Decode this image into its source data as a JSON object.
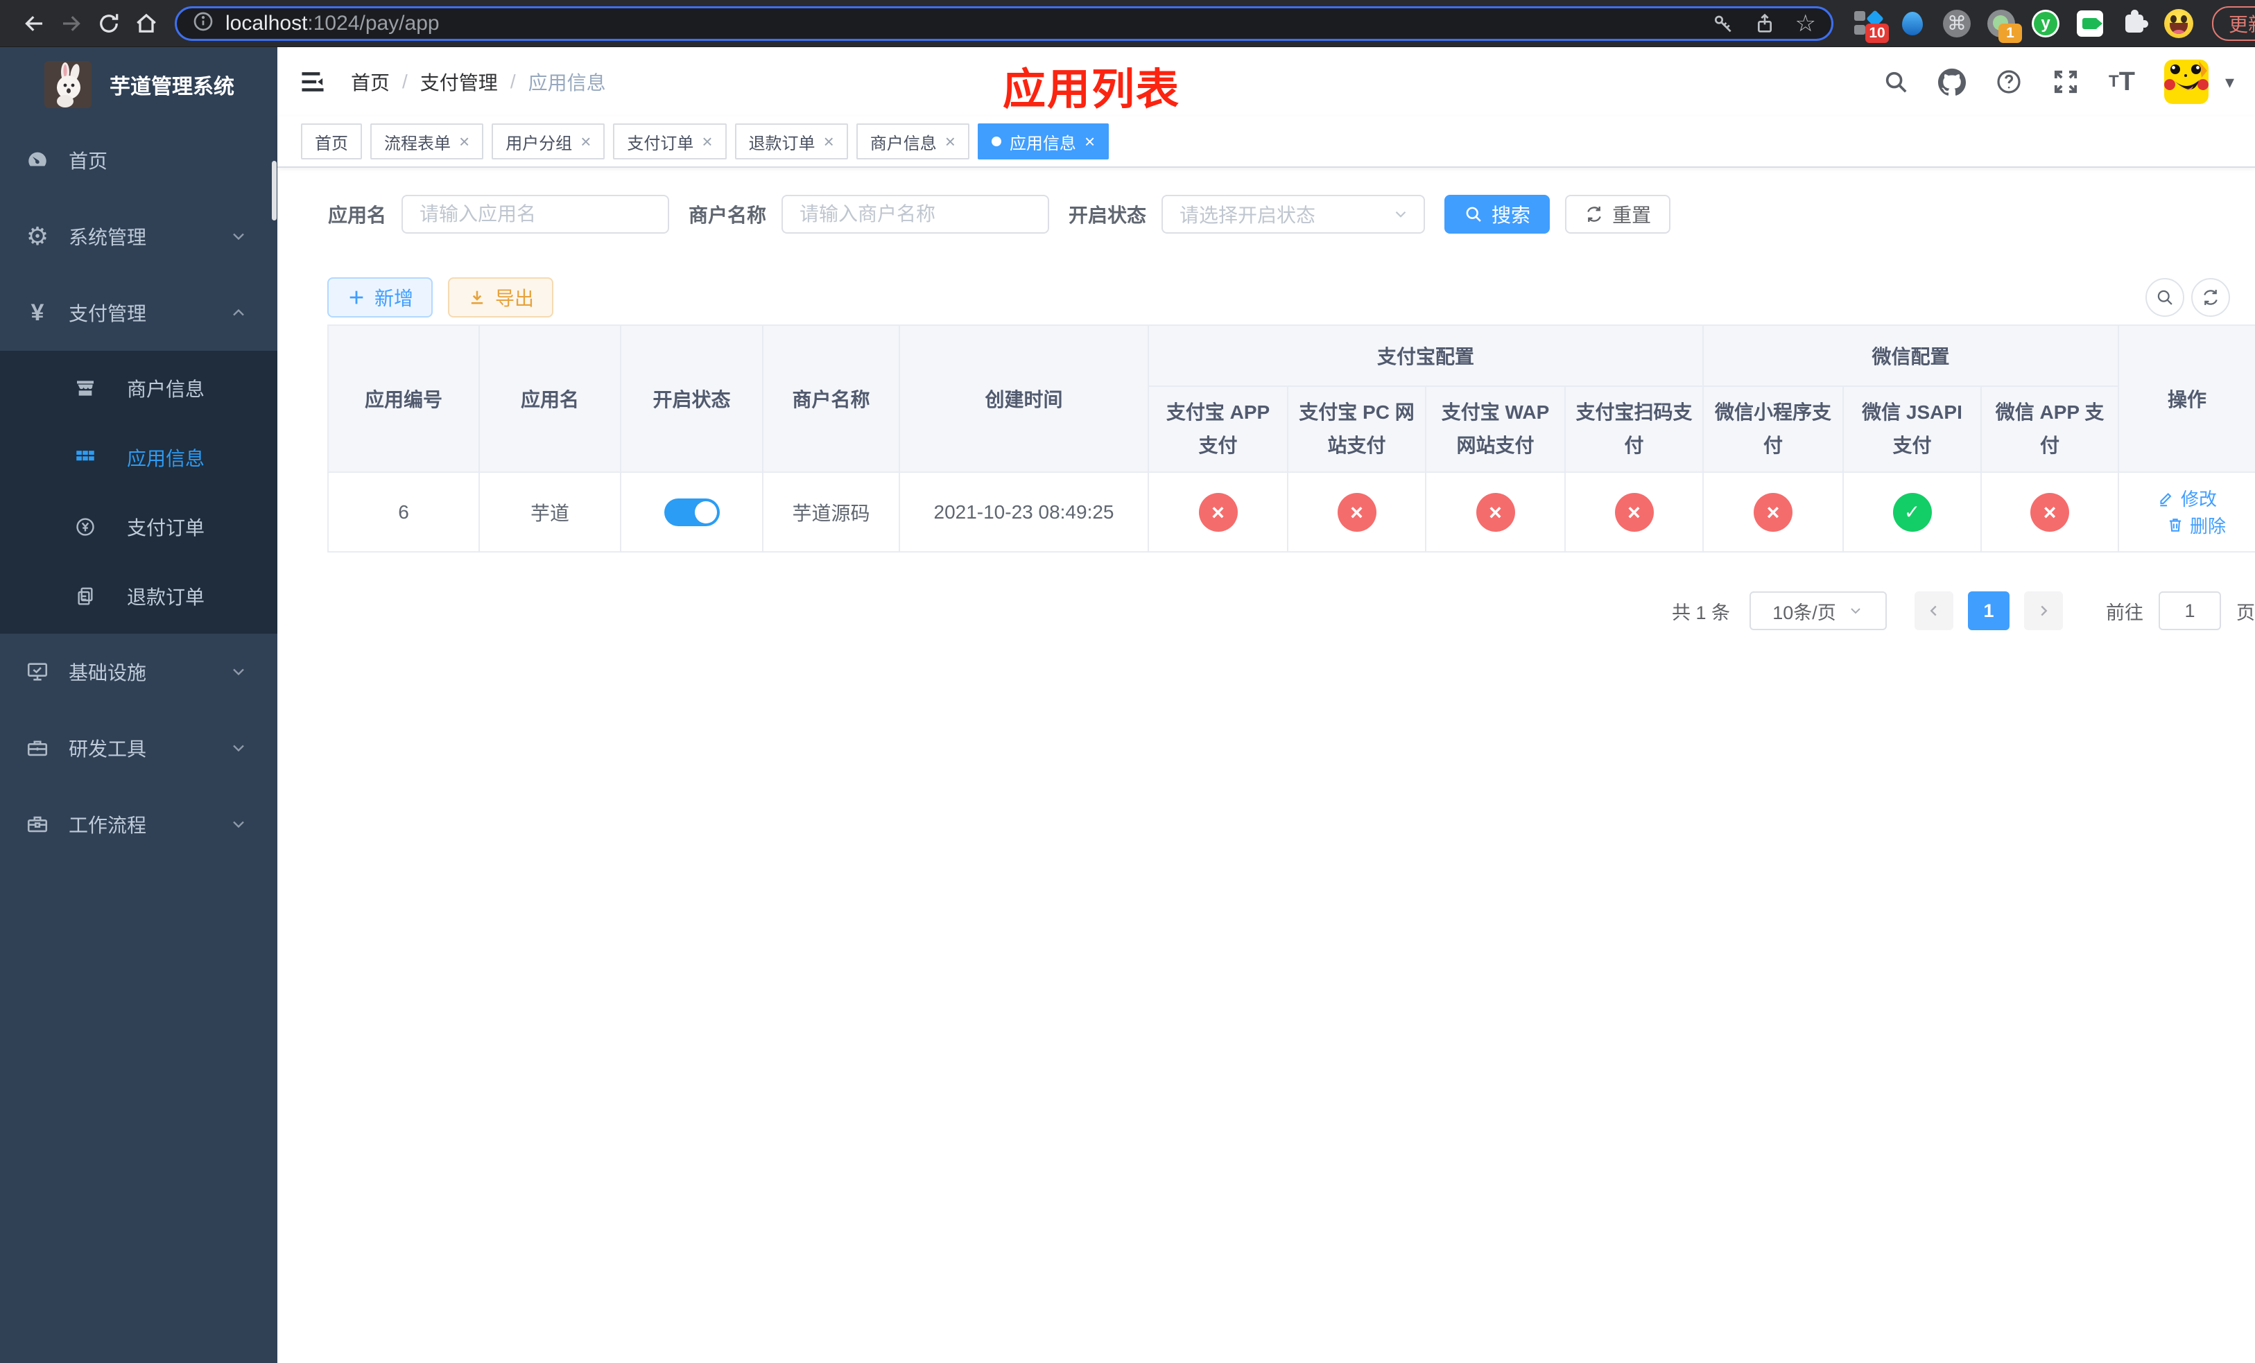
{
  "browser": {
    "url_host": "localhost",
    "url_rest": ":1024/pay/app",
    "ext_badge_10": "10",
    "ext_badge_1": "1",
    "ext_y_letter": "y",
    "cmd_glyph": "⌘",
    "update_label": "更新"
  },
  "sidebar": {
    "title": "芋道管理系统",
    "menu": [
      {
        "label": "首页"
      },
      {
        "label": "系统管理"
      },
      {
        "label": "支付管理"
      }
    ],
    "submenu": [
      {
        "label": "商户信息"
      },
      {
        "label": "应用信息"
      },
      {
        "label": "支付订单"
      },
      {
        "label": "退款订单"
      }
    ],
    "menu2": [
      {
        "label": "基础设施"
      },
      {
        "label": "研发工具"
      },
      {
        "label": "工作流程"
      }
    ]
  },
  "header": {
    "breadcrumb": [
      "首页",
      "支付管理",
      "应用信息"
    ],
    "separator": "/",
    "annotation": "应用列表"
  },
  "tabs": [
    {
      "label": "首页"
    },
    {
      "label": "流程表单"
    },
    {
      "label": "用户分组"
    },
    {
      "label": "支付订单"
    },
    {
      "label": "退款订单"
    },
    {
      "label": "商户信息"
    },
    {
      "label": "应用信息"
    }
  ],
  "filters": {
    "app_name_label": "应用名",
    "app_name_placeholder": "请输入应用名",
    "merchant_label": "商户名称",
    "merchant_placeholder": "请输入商户名称",
    "status_label": "开启状态",
    "status_placeholder": "请选择开启状态",
    "search_label": "搜索",
    "reset_label": "重置"
  },
  "toolbar": {
    "add_label": "新增",
    "export_label": "导出"
  },
  "table": {
    "groups": {
      "alipay": "支付宝配置",
      "wechat": "微信配置"
    },
    "columns": [
      "应用编号",
      "应用名",
      "开启状态",
      "商户名称",
      "创建时间",
      "支付宝 APP 支付",
      "支付宝 PC 网站支付",
      "支付宝 WAP 网站支付",
      "支付宝扫码支付",
      "微信小程序支付",
      "微信 JSAPI 支付",
      "微信 APP 支付",
      "操作"
    ],
    "row": {
      "id": "6",
      "name": "芋道",
      "merchant": "芋道源码",
      "created": "2021-10-23 08:49:25",
      "statuses": [
        "no",
        "no",
        "no",
        "no",
        "no",
        "yes",
        "no"
      ],
      "edit_label": "修改",
      "delete_label": "删除"
    }
  },
  "pagination": {
    "total": "共 1 条",
    "page_size": "10条/页",
    "page": "1",
    "goto_label": "前往",
    "goto_value": "1",
    "page_unit": "页"
  },
  "colors": {
    "accent": "#409eff",
    "success": "#13ce66",
    "danger": "#f56c6c",
    "warning": "#e6a23c",
    "annotation_red": "#fb2410",
    "sidebar_bg": "#304156",
    "sidebar_submenu_bg": "#1f2d3d"
  }
}
